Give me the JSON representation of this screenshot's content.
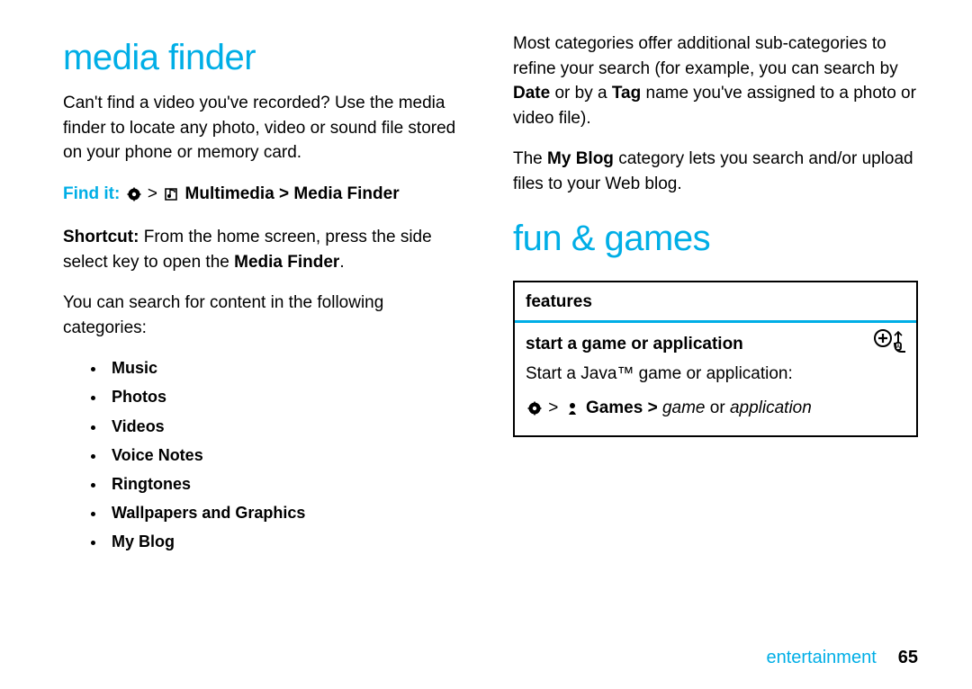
{
  "left": {
    "heading": "media finder",
    "intro": "Can't find a video you've recorded? Use the media finder to locate any photo, video or sound file stored on your phone or memory card.",
    "findit_label": "Find it:",
    "findit_path1": "Multimedia",
    "findit_path2": "Media Finder",
    "shortcut_label": "Shortcut:",
    "shortcut_text_a": " From the home screen, press the side select key to open the ",
    "shortcut_text_b": "Media Finder",
    "shortcut_text_c": ".",
    "categories_intro": "You can search for content in the following categories:",
    "categories": [
      "Music",
      "Photos",
      "Videos",
      "Voice Notes",
      "Ringtones",
      "Wallpapers and Graphics",
      "My Blog"
    ]
  },
  "right": {
    "para1_a": "Most categories offer additional sub-categories to refine your search (for example, you can search by ",
    "para1_b": "Date",
    "para1_c": " or by a ",
    "para1_d": "Tag",
    "para1_e": " name you've assigned to a photo or video file).",
    "para2_a": "The ",
    "para2_b": "My Blog",
    "para2_c": " category lets you search and/or upload files to your Web blog.",
    "heading": "fun & games",
    "table": {
      "header": "features",
      "row_title": "start a game or application",
      "row_desc": "Start a Java™ game or application:",
      "path_games": "Games",
      "path_item_a": "game",
      "path_or": " or ",
      "path_item_b": "application"
    }
  },
  "footer": {
    "section": "entertainment",
    "page": "65"
  }
}
